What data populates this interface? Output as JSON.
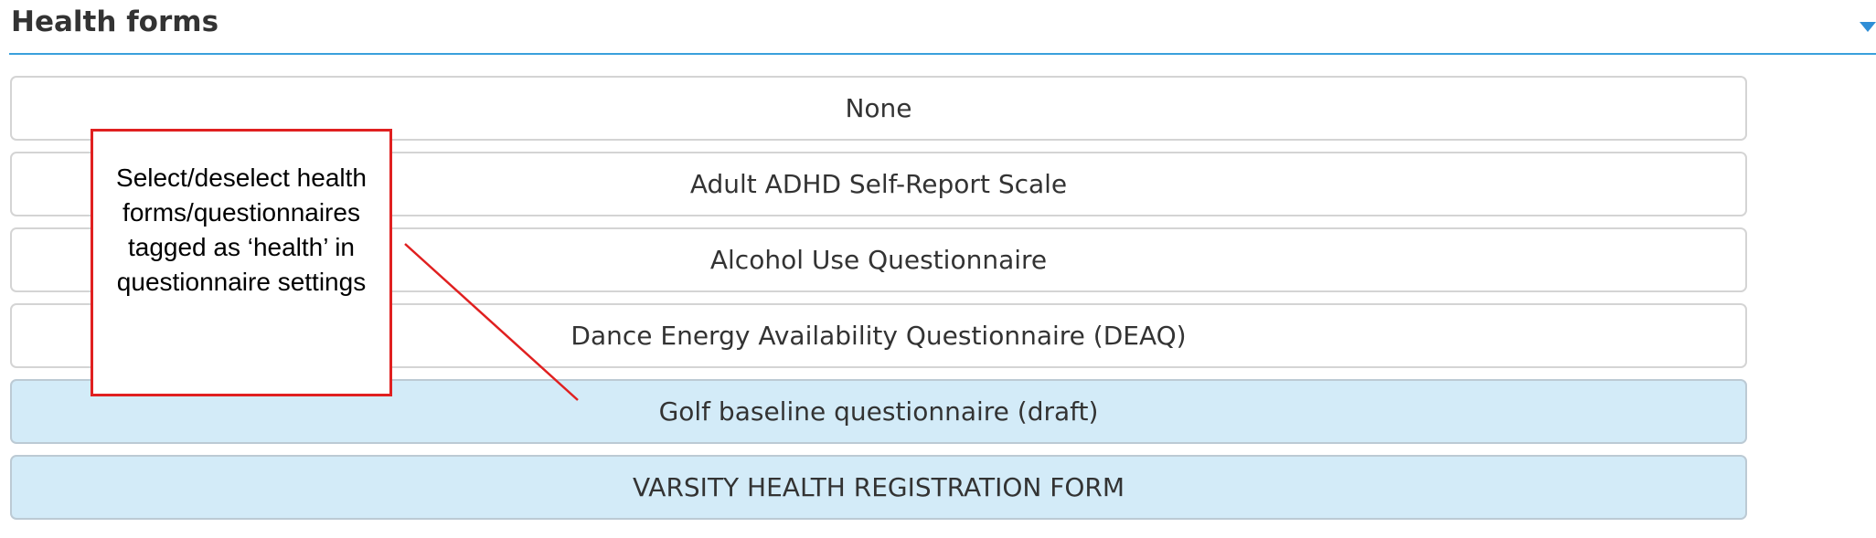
{
  "section": {
    "title": "Health forms",
    "collapse_icon": "chevron-down-icon"
  },
  "options": [
    {
      "label": "None",
      "selected": false
    },
    {
      "label": "Adult ADHD Self-Report Scale",
      "selected": false
    },
    {
      "label": "Alcohol Use Questionnaire",
      "selected": false
    },
    {
      "label": "Dance Energy Availability Questionnaire (DEAQ)",
      "selected": false
    },
    {
      "label": "Golf baseline questionnaire (draft)",
      "selected": true
    },
    {
      "label": "VARSITY HEALTH REGISTRATION FORM",
      "selected": true
    }
  ],
  "callout": {
    "text": "Select/deselect health forms/questionnaires tagged as ‘health’ in questionnaire settings",
    "border_color": "#e02020"
  },
  "colors": {
    "accent": "#3aa0dc",
    "selected_background": "#d3ebf8",
    "annotation": "#e02020"
  }
}
